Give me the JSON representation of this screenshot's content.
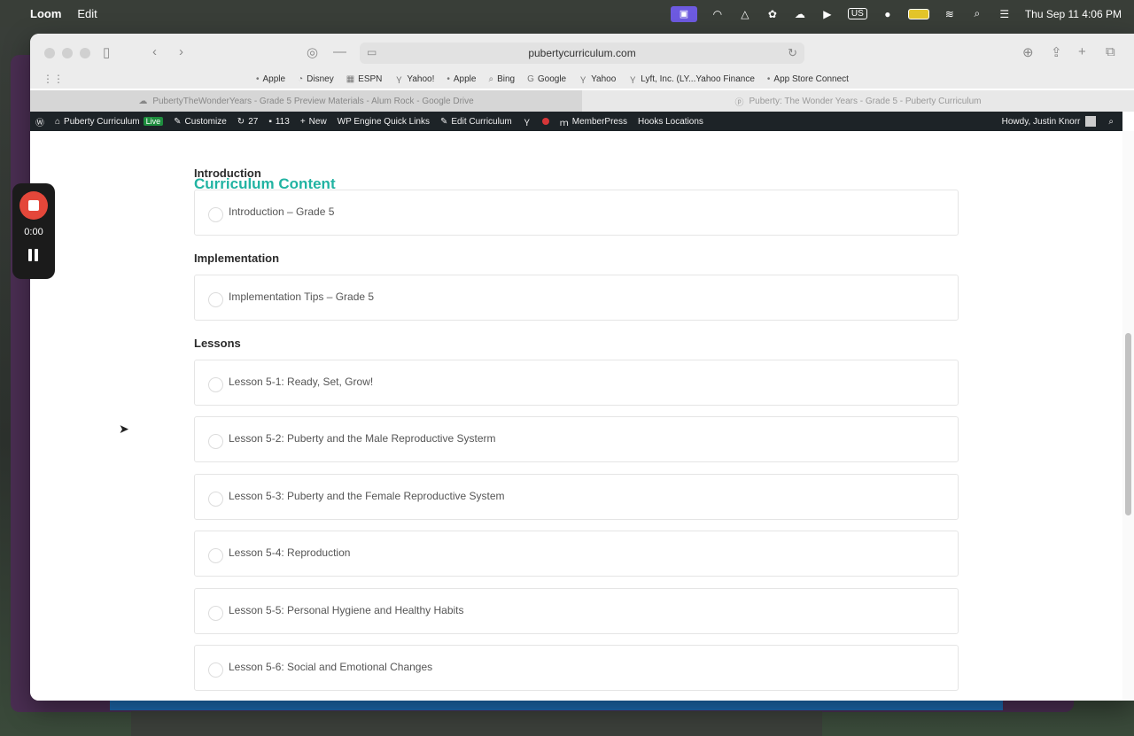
{
  "menubar": {
    "app_name": "Loom",
    "menu_edit": "Edit",
    "input_source": "US",
    "datetime": "Thu Sep 11  4:06 PM"
  },
  "browser": {
    "url": "pubertycurriculum.com",
    "bookmarks": [
      "Apple",
      "Disney",
      "ESPN",
      "Yahoo!",
      "Apple",
      "Bing",
      "Google",
      "Yahoo",
      "Lyft, Inc. (LY...Yahoo Finance",
      "App Store Connect"
    ],
    "tabs": [
      {
        "title": "PubertyTheWonderYears - Grade 5 Preview Materials - Alum Rock - Google Drive"
      },
      {
        "title": "Puberty: The Wonder Years - Grade 5 - Puberty Curriculum"
      }
    ]
  },
  "wpbar": {
    "site_name": "Puberty Curriculum",
    "live_badge": "Live",
    "customize": "Customize",
    "updates_count": "27",
    "comments_count": "113",
    "new": "New",
    "wp_engine": "WP Engine Quick Links",
    "edit_curriculum": "Edit Curriculum",
    "memberpress": "MemberPress",
    "hooks": "Hooks Locations",
    "howdy": "Howdy, Justin Knorr"
  },
  "page": {
    "section_title": "Curriculum Content",
    "groups": [
      {
        "heading": "Introduction",
        "items": [
          "Introduction – Grade 5"
        ]
      },
      {
        "heading": "Implementation",
        "items": [
          "Implementation Tips – Grade 5"
        ]
      },
      {
        "heading": "Lessons",
        "items": [
          "Lesson 5-1: Ready, Set, Grow!",
          "Lesson 5-2: Puberty and the Male Reproductive Systerm",
          "Lesson 5-3: Puberty and the Female Reproductive System",
          "Lesson 5-4: Reproduction",
          "Lesson 5-5: Personal Hygiene and Healthy Habits",
          "Lesson 5-6: Social and Emotional Changes"
        ]
      }
    ]
  },
  "loom": {
    "timer": "0:00"
  },
  "colors": {
    "accent_teal": "#21b3a2",
    "loom_record": "#e4473a",
    "wp_bar": "#1d2327"
  }
}
